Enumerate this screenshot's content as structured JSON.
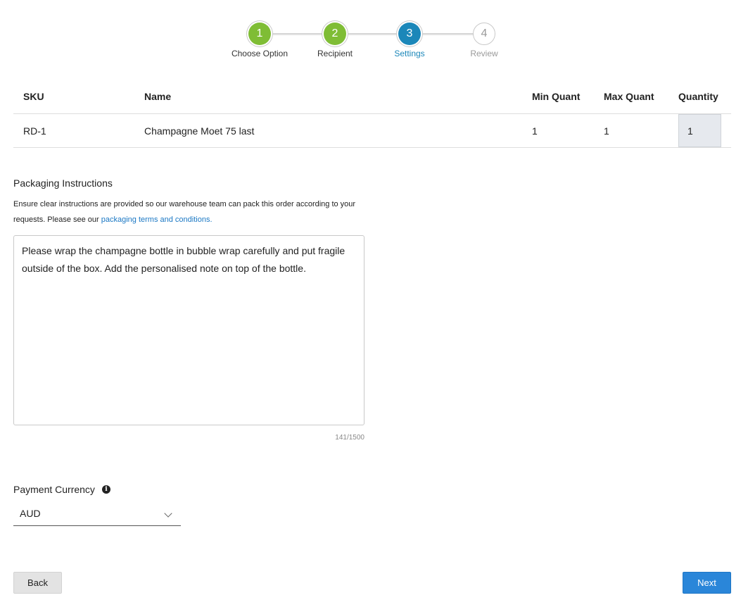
{
  "stepper": {
    "steps": [
      {
        "number": "1",
        "label": "Choose Option",
        "state": "done"
      },
      {
        "number": "2",
        "label": "Recipient",
        "state": "done"
      },
      {
        "number": "3",
        "label": "Settings",
        "state": "active"
      },
      {
        "number": "4",
        "label": "Review",
        "state": "todo"
      }
    ]
  },
  "table": {
    "headers": {
      "sku": "SKU",
      "name": "Name",
      "min": "Min Quant",
      "max": "Max Quant",
      "quantity": "Quantity"
    },
    "rows": [
      {
        "sku": "RD-1",
        "name": "Champagne Moet 75 last",
        "min": "1",
        "max": "1",
        "quantity": "1"
      }
    ]
  },
  "packaging": {
    "title": "Packaging Instructions",
    "description": "Ensure clear instructions are provided so our warehouse team can pack this order according to your requests. Please see our ",
    "link_text": "packaging terms and conditions.",
    "value": "Please wrap the champagne bottle in bubble wrap carefully and put fragile outside of the box. Add the personalised note on top of the bottle.",
    "counter": "141/1500"
  },
  "payment": {
    "label": "Payment Currency",
    "info_icon": "info-icon",
    "selected": "AUD"
  },
  "buttons": {
    "back": "Back",
    "next": "Next"
  },
  "colors": {
    "done": "#7fbd35",
    "active": "#1b87b9",
    "primary_button": "#2a86d9",
    "link": "#1b78c4"
  }
}
